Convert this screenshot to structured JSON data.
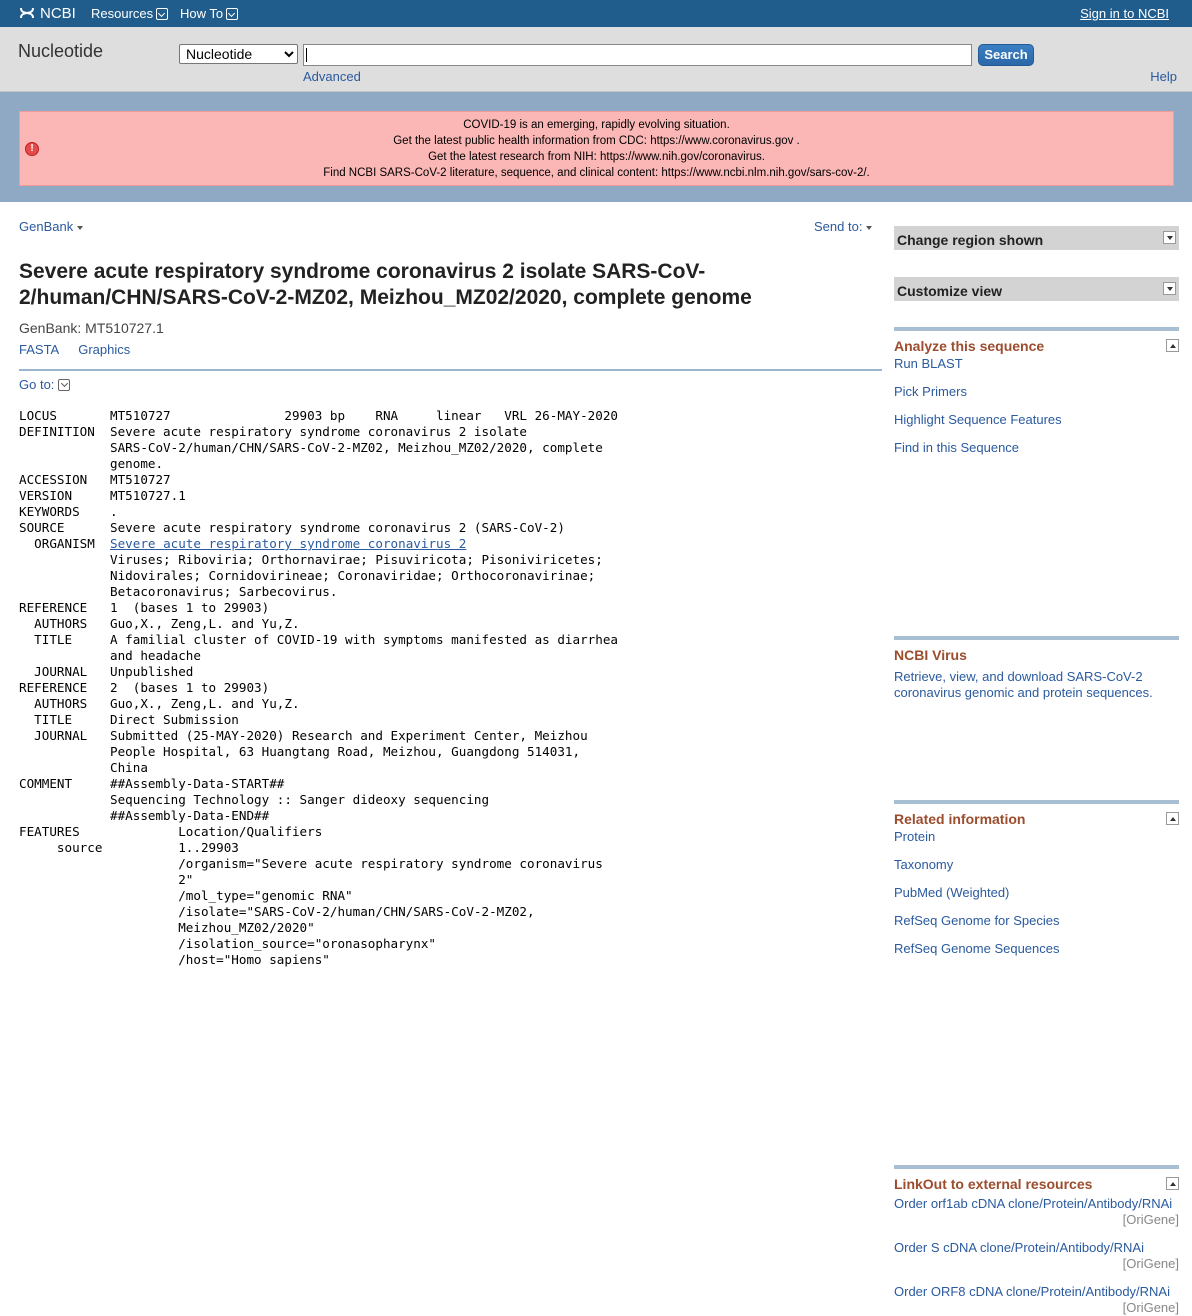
{
  "topbar": {
    "logo_text": "NCBI",
    "resources_label": "Resources",
    "howto_label": "How To",
    "signin_label": "Sign in to NCBI"
  },
  "search": {
    "db_title": "Nucleotide",
    "db_selected": "Nucleotide",
    "query": "",
    "button_label": "Search",
    "advanced_label": "Advanced",
    "help_label": "Help"
  },
  "alert": {
    "line1": "COVID-19 is an emerging, rapidly evolving situation.",
    "line2_text": "Get the latest public health information from CDC: ",
    "line2_link": "https://www.coronavirus.gov",
    "line2_end": " .",
    "line3_text": "Get the latest research from NIH: ",
    "line3_link": "https://www.nih.gov/coronavirus",
    "line3_end": ".",
    "line4_text": "Find NCBI SARS-CoV-2 literature, sequence, and clinical content: ",
    "line4_link": "https://www.ncbi.nlm.nih.gov/sars-cov-2/",
    "line4_end": "."
  },
  "record": {
    "format_label": "GenBank",
    "sendto_label": "Send to:",
    "title": "Severe acute respiratory syndrome coronavirus 2 isolate SARS-CoV-2/human/CHN/SARS-CoV-2-MZ02, Meizhou_MZ02/2020, complete genome",
    "accession_line": "GenBank: MT510727.1",
    "fasta_label": "FASTA",
    "graphics_label": "Graphics",
    "goto_label": "Go to:",
    "flat_pre": "LOCUS       MT510727               29903 bp    RNA     linear   VRL 26-MAY-2020\nDEFINITION  Severe acute respiratory syndrome coronavirus 2 isolate\n            SARS-CoV-2/human/CHN/SARS-CoV-2-MZ02, Meizhou_MZ02/2020, complete\n            genome.\nACCESSION   MT510727\nVERSION     MT510727.1\nKEYWORDS    .\nSOURCE      Severe acute respiratory syndrome coronavirus 2 (SARS-CoV-2)\n  ORGANISM  ",
    "organism_link": "Severe acute respiratory syndrome coronavirus 2",
    "flat_post": "\n            Viruses; Riboviria; Orthornavirae; Pisuviricota; Pisoniviricetes;\n            Nidovirales; Cornidovirineae; Coronaviridae; Orthocoronavirinae;\n            Betacoronavirus; Sarbecovirus.\nREFERENCE   1  (bases 1 to 29903)\n  AUTHORS   Guo,X., Zeng,L. and Yu,Z.\n  TITLE     A familial cluster of COVID-19 with symptoms manifested as diarrhea\n            and headache\n  JOURNAL   Unpublished\nREFERENCE   2  (bases 1 to 29903)\n  AUTHORS   Guo,X., Zeng,L. and Yu,Z.\n  TITLE     Direct Submission\n  JOURNAL   Submitted (25-MAY-2020) Research and Experiment Center, Meizhou\n            People Hospital, 63 Huangtang Road, Meizhou, Guangdong 514031,\n            China\nCOMMENT     ##Assembly-Data-START##\n            Sequencing Technology :: Sanger dideoxy sequencing\n            ##Assembly-Data-END##\nFEATURES             Location/Qualifiers\n     source          1..29903\n                     /organism=\"Severe acute respiratory syndrome coronavirus\n                     2\"\n                     /mol_type=\"genomic RNA\"\n                     /isolate=\"SARS-CoV-2/human/CHN/SARS-CoV-2-MZ02,\n                     Meizhou_MZ02/2020\"\n                     /isolation_source=\"oronasopharynx\"\n                     /host=\"Homo sapiens\""
  },
  "sidebar": {
    "change_region": "Change region shown",
    "customize_view": "Customize view",
    "analyze": {
      "title": "Analyze this sequence",
      "items": [
        "Run BLAST",
        "Pick Primers",
        "Highlight Sequence Features",
        "Find in this Sequence"
      ]
    },
    "virus": {
      "title": "NCBI Virus",
      "desc": "Retrieve, view, and download SARS-CoV-2 coronavirus genomic and protein sequences."
    },
    "related": {
      "title": "Related information",
      "items": [
        "Protein",
        "Taxonomy",
        "PubMed (Weighted)",
        "RefSeq Genome for Species",
        "RefSeq Genome Sequences"
      ]
    },
    "linkout": {
      "title": "LinkOut to external resources",
      "items": [
        {
          "label": "Order orf1ab cDNA clone/Protein/Antibody/RNAi",
          "source": "[OriGene]"
        },
        {
          "label": "Order S cDNA clone/Protein/Antibody/RNAi",
          "source": "[OriGene]"
        },
        {
          "label": "Order ORF8 cDNA clone/Protein/Antibody/RNAi",
          "source": "[OriGene]"
        }
      ]
    }
  },
  "colors": {
    "topbar": "#205d8d",
    "alert_bg": "#fbb6b6",
    "section_title": "#9b4d2e",
    "link": "#2a5a9f"
  }
}
